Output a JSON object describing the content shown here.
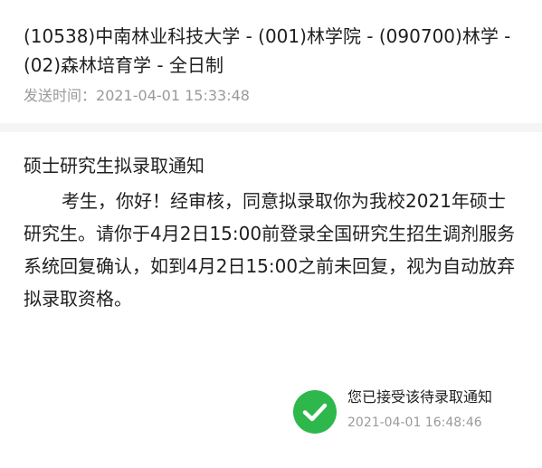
{
  "message": {
    "subject": "(10538)中南林业科技大学 - (001)林学院 - (090700)林学 - (02)森林培育学 - 全日制",
    "sent_label": "发送时间：",
    "sent_time": "2021-04-01 15:33:48"
  },
  "notice": {
    "title": "硕士研究生拟录取通知",
    "body": "考生，你好！经审核，同意拟录取你为我校2021年硕士研究生。请你于4月2日15:00前登录全国研究生招生调剂服务系统回复确认，如到4月2日15:00之前未回复，视为自动放弃拟录取资格。"
  },
  "acceptance": {
    "icon": "check-circle-icon",
    "status_text": "您已接受该待录取通知",
    "time": "2021-04-01 16:48:46",
    "color": "#2eb84b"
  }
}
